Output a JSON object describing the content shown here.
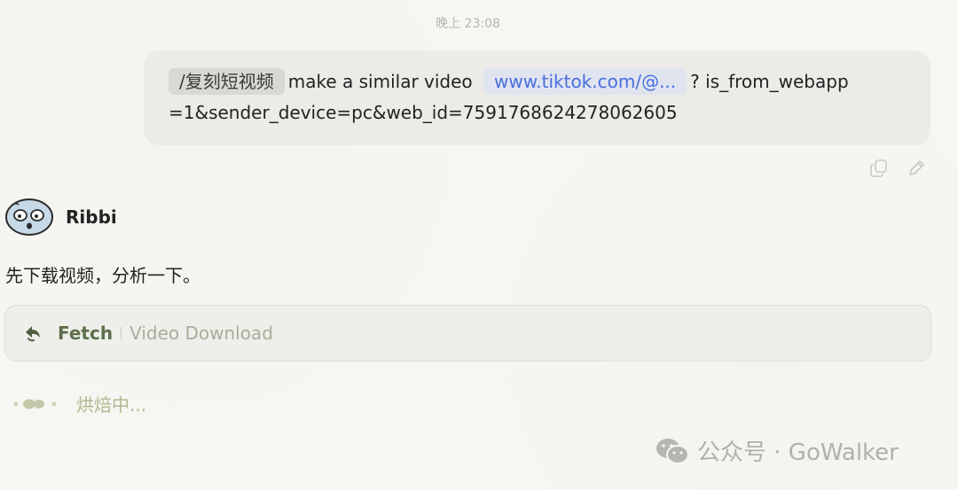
{
  "conversation": {
    "timestamp": "晚上 23:08",
    "user_message": {
      "command_tag": "/复刻短视频",
      "text_before_link": "make a similar video",
      "link_text": "www.tiktok.com/@...",
      "text_after_link": "? is_from_webapp",
      "text_line2": "=1&sender_device=pc&web_id=7591768624278062605"
    },
    "message_actions": {
      "copy_icon": "copy-icon",
      "edit_icon": "pencil-icon"
    },
    "bot": {
      "name": "Ribbi",
      "avatar_icon": "ribbi-avatar",
      "reply_text": "先下载视频，分析一下。",
      "tool_call": {
        "icon": "fetch-arrow-icon",
        "name": "Fetch",
        "description": "Video Download"
      },
      "status_text": "烘焙中..."
    }
  },
  "watermark": {
    "label": "公众号 · GoWalker"
  },
  "colors": {
    "background": "#f7f6f2",
    "user_bubble": "#ecebe7",
    "link": "#4a6ee0",
    "tool_name": "#5c6e4a",
    "status": "#b3b78e"
  }
}
